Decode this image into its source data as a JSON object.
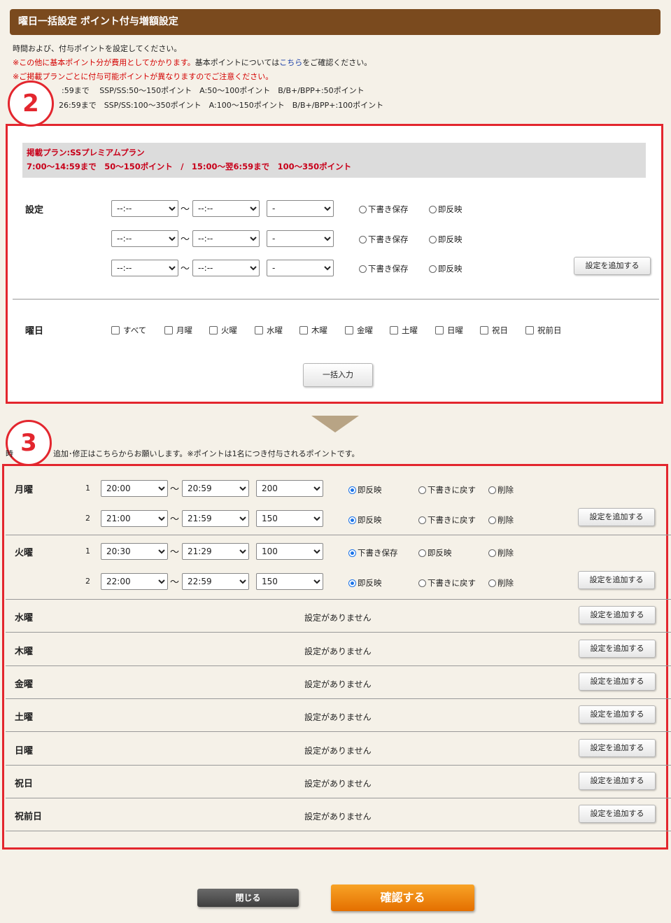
{
  "header": {
    "title": "曜日一括設定 ポイント付与増額設定"
  },
  "info": {
    "line1": "時間および、付与ポイントを設定してください。",
    "line2_red": "※この他に基本ポイント分が費用としてかかります。",
    "line2_a": "基本ポイントについては",
    "line2_link": "こちら",
    "line2_b": "をご確認ください。",
    "line3": "※ご掲載プランごとに付与可能ポイントが異なりますのでご注意ください。",
    "line4": ":59まで　 SSP/SS:50～150ポイント　A:50～100ポイント　B/B+/BPP+:50ポイント",
    "line5": "26:59まで　SSP/SS:100～350ポイント　A:100～150ポイント　B/B+/BPP+:100ポイント"
  },
  "step2": {
    "circle": "2",
    "plan_line1": "掲載プラン:SSプレミアムプラン",
    "plan_line2": "7:00～14:59まで　50～150ポイント　/　15:00～翌6:59まで　100～350ポイント",
    "settings_label": "設定",
    "tilde": "～",
    "time_placeholder": "--:--",
    "point_placeholder": "-",
    "radio_draft": "下書き保存",
    "radio_immediate": "即反映",
    "add_button": "設定を追加する",
    "weekday_label": "曜日",
    "days": [
      "すべて",
      "月曜",
      "火曜",
      "水曜",
      "木曜",
      "金曜",
      "土曜",
      "日曜",
      "祝日",
      "祝前日"
    ],
    "bulk_button": "一括入力"
  },
  "step3": {
    "circle": "3",
    "note": "追加･修正はこちらからお願いします。※ポイントは1名につき付与されるポイントです。",
    "note_prefix": "時",
    "add_button": "設定を追加する",
    "no_setting": "設定がありません",
    "monday": {
      "label": "月曜",
      "rows": [
        {
          "num": "1",
          "start": "20:00",
          "end": "20:59",
          "points": "200",
          "r1": "即反映",
          "r2": "下書きに戻す",
          "r3": "削除"
        },
        {
          "num": "2",
          "start": "21:00",
          "end": "21:59",
          "points": "150",
          "r1": "即反映",
          "r2": "下書きに戻す",
          "r3": "削除"
        }
      ]
    },
    "tuesday": {
      "label": "火曜",
      "rows": [
        {
          "num": "1",
          "start": "20:30",
          "end": "21:29",
          "points": "100",
          "r1": "下書き保存",
          "r2": "即反映",
          "r3": "削除"
        },
        {
          "num": "2",
          "start": "22:00",
          "end": "22:59",
          "points": "150",
          "r1": "即反映",
          "r2": "下書きに戻す",
          "r3": "削除"
        }
      ]
    },
    "empty_days": [
      "水曜",
      "木曜",
      "金曜",
      "土曜",
      "日曜",
      "祝日",
      "祝前日"
    ]
  },
  "footer": {
    "close": "閉じる",
    "confirm": "確認する"
  }
}
